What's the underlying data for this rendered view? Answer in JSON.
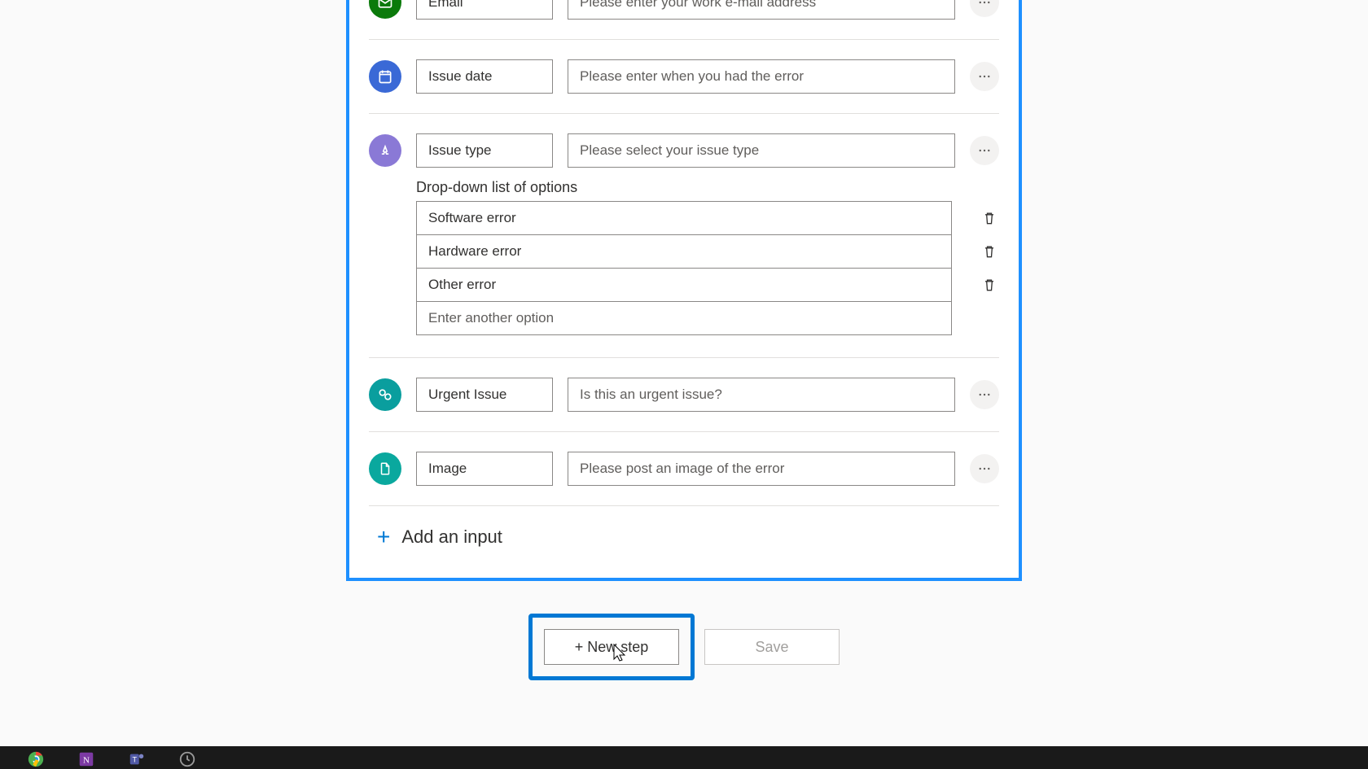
{
  "fields": [
    {
      "name": "Email",
      "placeholder": "Please enter your work e-mail address"
    },
    {
      "name": "Issue date",
      "placeholder": "Please enter when you had the error"
    },
    {
      "name": "Issue type",
      "placeholder": "Please select your issue type"
    },
    {
      "name": "Urgent Issue",
      "placeholder": "Is this an urgent issue?"
    },
    {
      "name": "Image",
      "placeholder": "Please post an image of the error"
    }
  ],
  "dropdown": {
    "label": "Drop-down list of options",
    "options": [
      "Software error",
      "Hardware error",
      "Other error"
    ],
    "new_option_placeholder": "Enter another option"
  },
  "add_input_label": "Add an input",
  "actions": {
    "new_step": "+ New step",
    "save": "Save"
  }
}
